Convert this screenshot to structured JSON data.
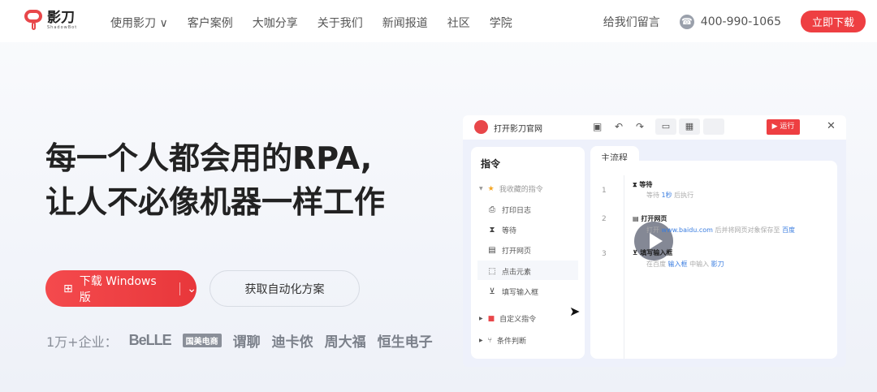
{
  "nav": {
    "logo_text": "影刀",
    "logo_sub": "ShadowBot",
    "menu": [
      "使用影刀 ∨",
      "客户案例",
      "大咖分享",
      "关于我们",
      "新闻报道",
      "社区",
      "学院"
    ],
    "feedback": "给我们留言",
    "phone": "400-990-1065",
    "download": "立即下载"
  },
  "hero": {
    "line1": "每一个人都会用的RPA,",
    "line2": "让人不必像机器一样工作"
  },
  "buttons": {
    "download": "下载 Windows 版",
    "chevron": "⌄",
    "solution": "获取自动化方案"
  },
  "clients": {
    "label": "1万+企业：",
    "logos": [
      "BeLLE",
      "国美电商",
      "谓聊",
      "迪卡侬",
      "周大福",
      "恒生电子"
    ]
  },
  "demo": {
    "title": "打开影刀官网",
    "run": "▶ 运行",
    "sidebar": {
      "title": "指令",
      "favorites": "我收藏的指令",
      "items": [
        "打印日志",
        "等待",
        "打开网页",
        "点击元素",
        "填写输入框"
      ],
      "custom": "自定义指令",
      "condition": "条件判断"
    },
    "tab": "主流程",
    "steps": [
      {
        "num": "1",
        "title": "等待",
        "desc": [
          "等待 ",
          "1秒",
          " 后执行"
        ]
      },
      {
        "num": "2",
        "title": "打开网页",
        "desc": [
          "打开 ",
          "www.baidu.com",
          " 后并将网页对象保存至 ",
          "百度"
        ]
      },
      {
        "num": "3",
        "title": "填写输入框",
        "desc": [
          "在百度 ",
          "输入框",
          " 中输入 ",
          "影刀"
        ]
      }
    ]
  },
  "colors": {
    "accent": "#ee3f42",
    "link": "#3a7de0"
  }
}
